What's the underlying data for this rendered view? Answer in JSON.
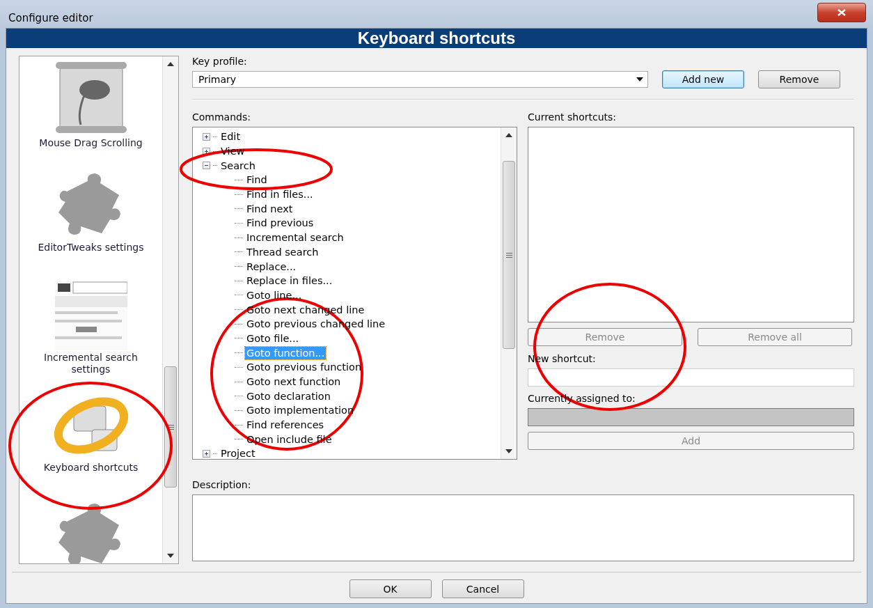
{
  "window": {
    "title": "Configure editor"
  },
  "header": "Keyboard shortcuts",
  "sidebar": {
    "items": [
      {
        "kind": "scroll",
        "label": "Mouse Drag Scrolling"
      },
      {
        "kind": "puzzle",
        "label": "EditorTweaks settings"
      },
      {
        "kind": "thumbnail",
        "label": "Incremental search settings"
      },
      {
        "kind": "ring",
        "label": "Keyboard shortcuts"
      },
      {
        "kind": "puzzle"
      }
    ]
  },
  "key_profile": {
    "label": "Key profile:",
    "value": "Primary",
    "buttons": [
      {
        "label": "Add new",
        "default": true
      },
      {
        "label": "Remove",
        "default": false
      }
    ]
  },
  "commands": {
    "label": "Commands:",
    "tree": [
      {
        "label": "Edit",
        "expanded": false,
        "selected": false
      },
      {
        "label": "View",
        "expanded": false,
        "selected": false
      },
      {
        "label": "Search",
        "expanded": true,
        "selected": false,
        "children": [
          {
            "label": "Find",
            "selected": false
          },
          {
            "label": "Find in files...",
            "selected": false
          },
          {
            "label": "Find next",
            "selected": false
          },
          {
            "label": "Find previous",
            "selected": false
          },
          {
            "label": "Incremental search",
            "selected": false
          },
          {
            "label": "Thread search",
            "selected": false
          },
          {
            "label": "Replace...",
            "selected": false
          },
          {
            "label": "Replace in files...",
            "selected": false
          },
          {
            "label": "Goto line...",
            "selected": false
          },
          {
            "label": "Goto next changed line",
            "selected": false
          },
          {
            "label": "Goto previous changed line",
            "selected": false
          },
          {
            "label": "Goto file...",
            "selected": false
          },
          {
            "label": "Goto function...",
            "selected": true
          },
          {
            "label": "Goto previous function",
            "selected": false
          },
          {
            "label": "Goto next function",
            "selected": false
          },
          {
            "label": "Goto declaration",
            "selected": false
          },
          {
            "label": "Goto implementation",
            "selected": false
          },
          {
            "label": "Find references",
            "selected": false
          },
          {
            "label": "Open include file",
            "selected": false
          }
        ]
      },
      {
        "label": "Project",
        "expanded": false,
        "selected": false
      }
    ]
  },
  "current_shortcuts": {
    "label": "Current shortcuts:",
    "buttons": [
      {
        "label": "Remove",
        "disabled": true
      },
      {
        "label": "Remove all",
        "disabled": true
      }
    ]
  },
  "new_shortcut": {
    "label": "New shortcut:"
  },
  "currently_assigned": {
    "label": "Currently assigned to:"
  },
  "add_button": {
    "label": "Add",
    "disabled": true
  },
  "description": {
    "label": "Description:"
  },
  "footer_buttons": [
    {
      "label": "OK"
    },
    {
      "label": "Cancel"
    }
  ]
}
